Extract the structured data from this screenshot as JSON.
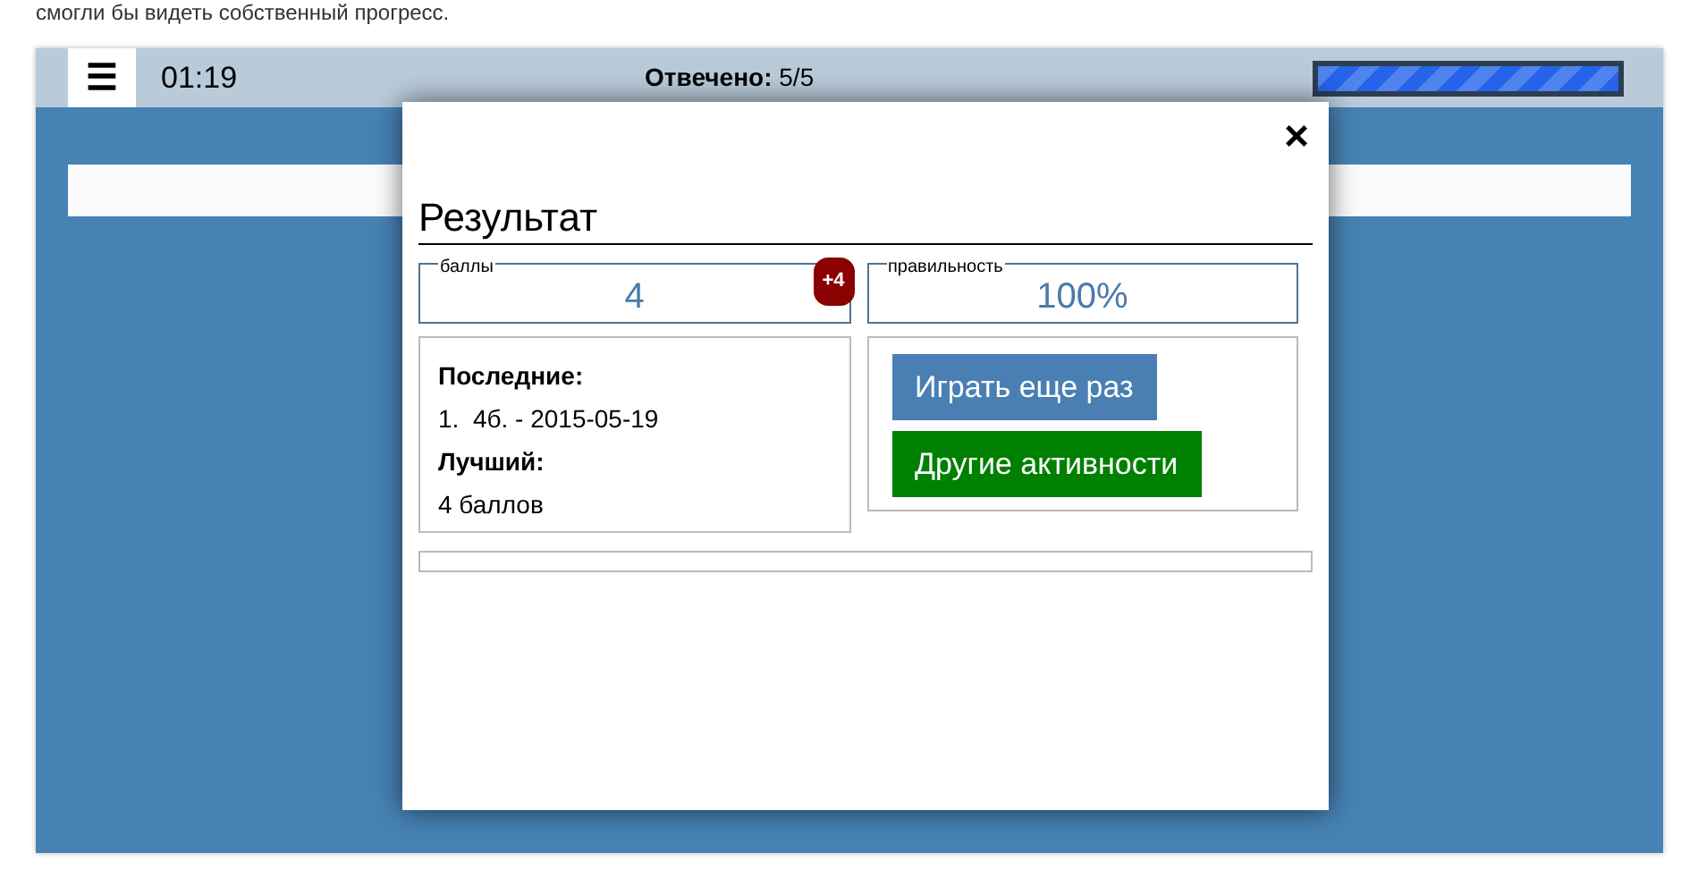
{
  "intro_text": "смогли бы видеть собственный прогресс.",
  "header": {
    "menu_icon": "☰",
    "timer": "01:19",
    "answered": "**Отвечено:** 5/5",
    "progress": {
      "level": 1
    }
  },
  "modal": {
    "close": "×",
    "title": "Результат",
    "stats": [
      {
        "legend": "баллы",
        "value": "4",
        "badge": "+4"
      },
      {
        "legend": "правильность",
        "value": "100%"
      }
    ],
    "history": [
      {
        "kind": "heading",
        "text": "Последние:"
      },
      {
        "kind": "line",
        "text": "1.  4б. - 2015-05-19"
      },
      {
        "kind": "heading",
        "text": "Лучший:"
      },
      {
        "kind": "line",
        "text": "4 баллов"
      }
    ],
    "buttons": [
      {
        "label": "Играть еще раз",
        "kind": "primary"
      },
      {
        "label": "Другие активности",
        "kind": "success"
      }
    ]
  }
}
